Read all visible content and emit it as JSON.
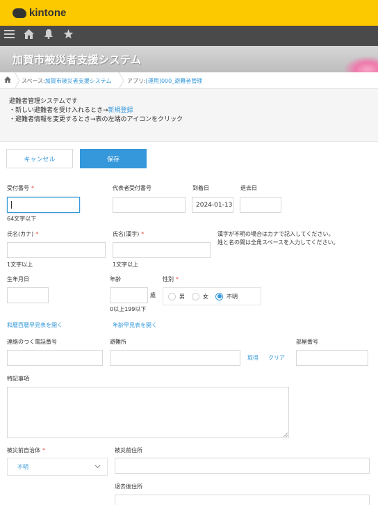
{
  "header": {
    "logo_text": "kintone",
    "brand_color": "#fcc800"
  },
  "nav": {
    "icons": [
      "menu-icon",
      "home-icon",
      "bell-icon",
      "star-icon"
    ]
  },
  "banner": {
    "title": "加賀市被災者支援システム"
  },
  "breadcrumb": {
    "space_prefix": "スペース:",
    "space_name": "加賀市被災者支援システム",
    "app_prefix": "アプリ:",
    "app_name": "[運用]000_避難者管理"
  },
  "description": {
    "line1": "避難者管理システムです",
    "line2_text": "・新しい避難者を受け入れるとき→",
    "line2_link": "新規登録",
    "line3": "・避難者情報を変更するとき→表の左端のアイコンをクリック"
  },
  "buttons": {
    "cancel": "キャンセル",
    "save": "保存"
  },
  "required_mark": "*",
  "fields": {
    "receipt_no": {
      "label": "受付番号",
      "value": "",
      "hint": "64文字以下"
    },
    "rep_receipt_no": {
      "label": "代表者受付番号",
      "value": ""
    },
    "arrival_date": {
      "label": "到着日",
      "value": "2024-01-13"
    },
    "leave_date": {
      "label": "退去日",
      "value": ""
    },
    "name_kana": {
      "label": "氏名(カナ)",
      "value": "",
      "hint": "1文字以上"
    },
    "name_kanji": {
      "label": "氏名(漢字)",
      "value": "",
      "hint": "1文字以上"
    },
    "name_note_line1": "漢字が不明の場合はカナで記入してください。",
    "name_note_line2": "姓と名の間は全角スペースを入力してください。",
    "birthdate": {
      "label": "生年月日",
      "value": ""
    },
    "age": {
      "label": "年齢",
      "value": "",
      "unit": "歳",
      "hint": "0以上199以下"
    },
    "gender": {
      "label": "性別",
      "options": [
        "男",
        "女",
        "不明"
      ],
      "selected": "不明"
    },
    "era_table_link": "和暦西暦早見表を開く",
    "age_table_link": "年齢早見表を開く",
    "phone": {
      "label": "連絡のつく電話番号",
      "value": ""
    },
    "shelter": {
      "label": "避難所",
      "value": "",
      "fetch_link": "取得",
      "clear_link": "クリア"
    },
    "room_no": {
      "label": "部屋番号",
      "value": ""
    },
    "notes": {
      "label": "特記事項",
      "value": ""
    },
    "prev_municipality": {
      "label": "被災前自治体",
      "selected": "不明"
    },
    "prev_address": {
      "label": "被災前住所",
      "value": ""
    },
    "after_address": {
      "label": "退去後住所",
      "value": ""
    }
  },
  "colors": {
    "accent": "#3498db",
    "required": "#e74c3c",
    "nav_bg": "#4a4a4a"
  }
}
